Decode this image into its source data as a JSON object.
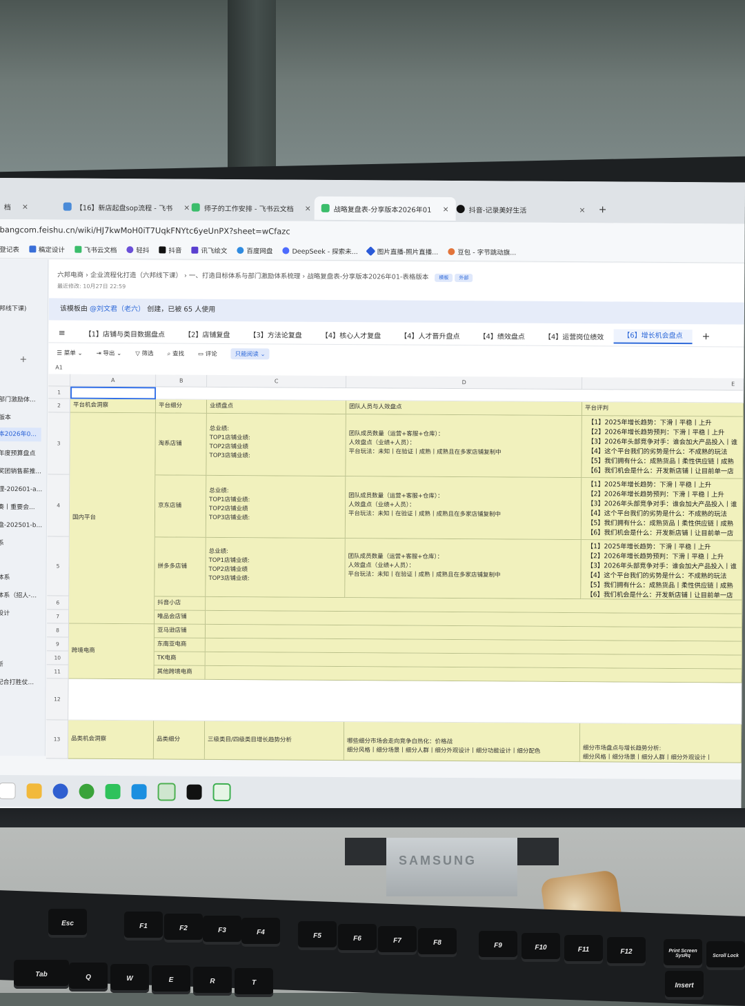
{
  "browser": {
    "tabs": [
      {
        "label": "档",
        "close": "×"
      },
      {
        "label": "【16】新店起盘sop流程 - 飞书",
        "close": "×"
      },
      {
        "label": "师子的工作安排 - 飞书云文档",
        "close": "×"
      },
      {
        "label": "战略复盘表-分享版本2026年01",
        "close": "×"
      },
      {
        "label": "抖音-记录美好生活",
        "close": "×"
      }
    ],
    "new_tab": "+",
    "url": "bangcom.feishu.cn/wiki/HJ7kwMoH0iT7UqkFNYtc6yeUnPX?sheet=wCfazc",
    "bookmarks": [
      "登记表",
      "稿定设计",
      "飞书云文档",
      "轻抖",
      "抖音",
      "讯飞绘文",
      "百度网盘",
      "DeepSeek - 探索未...",
      "图片直播-照片直播...",
      "豆包 - 字节跳动旗..."
    ]
  },
  "sidebar": {
    "items": [
      "邦线下课)",
      "部门激励体...",
      "版本",
      "本2026年0...",
      "年度预算盘点",
      "奖团销售薪推...",
      "理-202601-a...",
      "奏丨重要会...",
      "盘-202501-b...",
      "系",
      "体系",
      "体系（招人-...",
      "设计",
      "断",
      "配合打胜仗..."
    ],
    "add": "+"
  },
  "doc": {
    "breadcrumb": [
      "六邦电商",
      "企业流程化打造（六邦线下课）",
      "一、打造目标体系与部门激励体系梳理",
      "战略复盘表-分享版本2026年01-表格版本"
    ],
    "badges": [
      "模板",
      "外部"
    ],
    "last_edited": "最近修改: 10月27日 22:59",
    "banner_pre": "该模板由",
    "banner_author": "@刘文君（老六）",
    "banner_post": "创建，已被 65 人使用"
  },
  "sheet_tabs": [
    "【1】店铺与类目数据盘点",
    "【2】店铺复盘",
    "【3】方法论复盘",
    "【4】核心人才复盘",
    "【4】人才晋升盘点",
    "【4】绩效盘点",
    "【4】运营岗位绩效",
    "【6】增长机会盘点"
  ],
  "add_sheet": "+",
  "toolbar": {
    "menu": "菜单",
    "export": "导出",
    "filter": "筛选",
    "find": "查找",
    "comment": "评论",
    "readonly": "只能阅读"
  },
  "cell_ref": "A1",
  "columns": [
    "A",
    "B",
    "C",
    "D",
    "E"
  ],
  "rows": {
    "numbers": [
      "1",
      "2",
      "3",
      "4",
      "5",
      "6",
      "7",
      "8",
      "9",
      "10",
      "11",
      "12",
      "13"
    ],
    "header": [
      "平台机会洞察",
      "平台细分",
      "业绩盘点",
      "团队人员与人效盘点",
      "平台评判"
    ],
    "domestic_label": "国内平台",
    "crossborder_label": "跨境电商",
    "category_label": "品类机会洞察",
    "category_sub": "品类细分",
    "category_c": "三级类目/四级类目增长趋势分析",
    "category_d": "哪些细分市场会走向竞争白热化：价格战\n细分风格丨细分场景丨细分人群丨细分外观设计丨细分功能设计丨细分配色",
    "category_e": "细分市场盘点与增长趋势分析:\n细分风格丨细分场景丨细分人群丨细分外观设计丨",
    "shops": [
      "淘系店铺",
      "京东店铺",
      "拼多多店铺",
      "抖音小店",
      "唯品会店铺",
      "亚马逊店铺",
      "东南亚电商",
      "TK电商",
      "其他跨境电商"
    ],
    "perf": "总业绩:\nTOP1店铺业绩:\nTOP2店铺业绩\nTOP3店铺业绩:",
    "team": "团队成员数量（运营+客服+仓库）：\n人效盘点（业绩+人员）：\n平台玩法：未知丨在验证丨成熟丨成熟且在多家店铺复制中",
    "judge": "【1】2025年增长趋势：下滑丨平稳丨上升\n【2】2026年增长趋势预判：下滑丨平稳丨上升\n【3】2026年头部竞争对手：谁会加大产品投入丨谁\n【4】这个平台我们的劣势是什么：不成熟的玩法\n【5】我们拥有什么：成熟货品丨柔性供应链丨成熟\n【6】我们机会是什么：开发新店铺丨让目前单一店"
  },
  "keyboard": {
    "keys": [
      "Esc",
      "F1",
      "F2",
      "F3",
      "F4",
      "F5",
      "F6",
      "F7",
      "F8",
      "F9",
      "F10",
      "F11",
      "F12",
      "Print Screen SysRq",
      "Scroll Lock",
      "Tab",
      "Q",
      "W",
      "E",
      "R",
      "T",
      "Insert"
    ]
  },
  "monitor_brand": "SAMSUNG"
}
